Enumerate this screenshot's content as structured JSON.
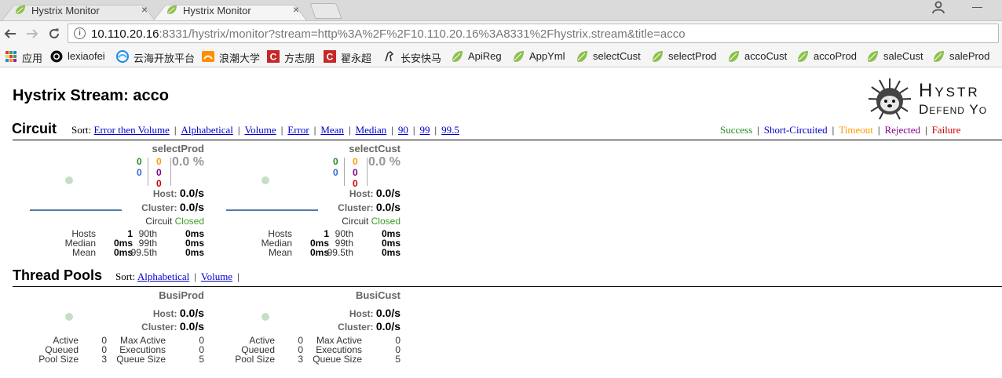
{
  "tabs": [
    {
      "title": "Hystrix Monitor",
      "close": "×",
      "active": false
    },
    {
      "title": "Hystrix Monitor",
      "close": "×",
      "active": true
    }
  ],
  "window": {
    "minimize": "—"
  },
  "address_bar": {
    "host": "10.110.20.16",
    "rest": ":8331/hystrix/monitor?stream=http%3A%2F%2F10.110.20.16%3A8331%2Fhystrix.stream&title=acco"
  },
  "bookmarks": [
    {
      "label": "应用",
      "icon": "apps-grid-icon"
    },
    {
      "label": "lexiaofei",
      "icon": "github-icon"
    },
    {
      "label": "云海开放平台",
      "icon": "cloud-sea-icon"
    },
    {
      "label": "浪潮大学",
      "icon": "inspur-icon"
    },
    {
      "label": "方志朋",
      "icon": "csdn-icon"
    },
    {
      "label": "翟永超",
      "icon": "csdn-icon"
    },
    {
      "label": "长安快马",
      "icon": "horse-icon"
    },
    {
      "label": "ApiReg",
      "icon": "spring-leaf-icon"
    },
    {
      "label": "AppYml",
      "icon": "spring-leaf-icon"
    },
    {
      "label": "selectCust",
      "icon": "spring-leaf-icon"
    },
    {
      "label": "selectProd",
      "icon": "spring-leaf-icon"
    },
    {
      "label": "accoCust",
      "icon": "spring-leaf-icon"
    },
    {
      "label": "accoProd",
      "icon": "spring-leaf-icon"
    },
    {
      "label": "saleCust",
      "icon": "spring-leaf-icon"
    },
    {
      "label": "saleProd",
      "icon": "spring-leaf-icon"
    }
  ],
  "page": {
    "title": "Hystrix Stream: acco"
  },
  "logo": {
    "line1": "Hystr",
    "line2": "Defend Yo"
  },
  "circuit": {
    "title": "Circuit",
    "sort_label": "Sort:",
    "sort_options": [
      "Error then Volume",
      "Alphabetical",
      "Volume",
      "Error",
      "Mean",
      "Median",
      "90",
      "99",
      "99.5"
    ],
    "legend": [
      {
        "label": "Success",
        "color": "#228b22"
      },
      {
        "label": "Short-Circuited",
        "color": "#0000cc"
      },
      {
        "label": "Timeout",
        "color": "#ff9900"
      },
      {
        "label": "Rejected",
        "color": "#800080"
      },
      {
        "label": "Failure",
        "color": "#cc0000"
      }
    ],
    "monitors": [
      {
        "name": "selectProd",
        "success": "0",
        "short_circuited": "0",
        "timeout": "0",
        "rejected": "0",
        "failure": "0",
        "error_pct": "0.0 %",
        "host_label": "Host:",
        "host_rate": "0.0/s",
        "cluster_label": "Cluster:",
        "cluster_rate": "0.0/s",
        "circuit_label": "Circuit",
        "circuit_state": "Closed",
        "hosts_label": "Hosts",
        "hosts": "1",
        "median_label": "Median",
        "median": "0ms",
        "mean_label": "Mean",
        "mean": "0ms",
        "p90_label": "90th",
        "p90": "0ms",
        "p99_label": "99th",
        "p99": "0ms",
        "p995_label": "99.5th",
        "p995": "0ms"
      },
      {
        "name": "selectCust",
        "success": "0",
        "short_circuited": "0",
        "timeout": "0",
        "rejected": "0",
        "failure": "0",
        "error_pct": "0.0 %",
        "host_label": "Host:",
        "host_rate": "0.0/s",
        "cluster_label": "Cluster:",
        "cluster_rate": "0.0/s",
        "circuit_label": "Circuit",
        "circuit_state": "Closed",
        "hosts_label": "Hosts",
        "hosts": "1",
        "median_label": "Median",
        "median": "0ms",
        "mean_label": "Mean",
        "mean": "0ms",
        "p90_label": "90th",
        "p90": "0ms",
        "p99_label": "99th",
        "p99": "0ms",
        "p995_label": "99.5th",
        "p995": "0ms"
      }
    ]
  },
  "thread_pools": {
    "title": "Thread Pools",
    "sort_label": "Sort:",
    "sort_options": [
      "Alphabetical",
      "Volume"
    ],
    "pools": [
      {
        "name": "BusiProd",
        "host_label": "Host:",
        "host_rate": "0.0/s",
        "cluster_label": "Cluster:",
        "cluster_rate": "0.0/s",
        "active_label": "Active",
        "active": "0",
        "queued_label": "Queued",
        "queued": "0",
        "pool_size_label": "Pool Size",
        "pool_size": "3",
        "max_active_label": "Max Active",
        "max_active": "0",
        "executions_label": "Executions",
        "executions": "0",
        "queue_size_label": "Queue Size",
        "queue_size": "5"
      },
      {
        "name": "BusiCust",
        "host_label": "Host:",
        "host_rate": "0.0/s",
        "cluster_label": "Cluster:",
        "cluster_rate": "0.0/s",
        "active_label": "Active",
        "active": "0",
        "queued_label": "Queued",
        "queued": "0",
        "pool_size_label": "Pool Size",
        "pool_size": "3",
        "max_active_label": "Max Active",
        "max_active": "0",
        "executions_label": "Executions",
        "executions": "0",
        "queue_size_label": "Queue Size",
        "queue_size": "5"
      }
    ]
  }
}
